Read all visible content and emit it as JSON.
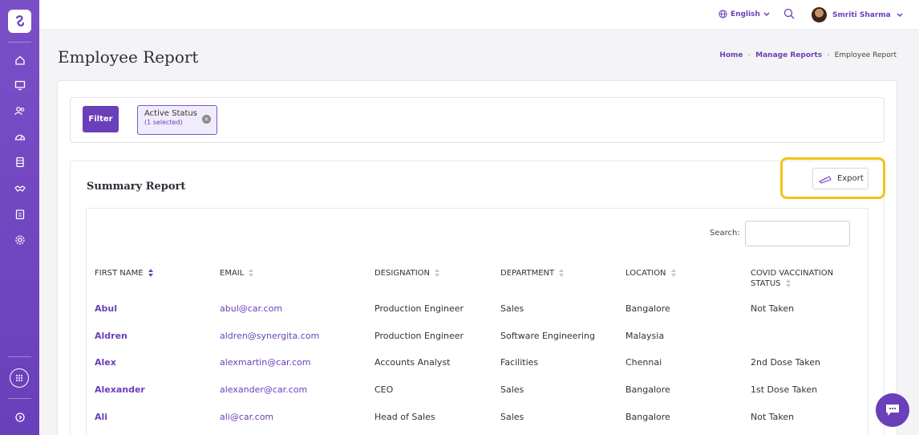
{
  "sidebar": {
    "icons": [
      "logo-icon",
      "home-icon",
      "monitor-icon",
      "users-icon",
      "dashboard-icon",
      "database-icon",
      "handshake-icon",
      "clipboard-icon",
      "settings-icon",
      "apps-icon",
      "info-icon"
    ]
  },
  "topbar": {
    "language": "English",
    "user_name": "Smriti Sharma"
  },
  "page": {
    "title": "Employee Report",
    "breadcrumb": [
      "Home",
      "Manage Reports",
      "Employee Report"
    ]
  },
  "filter": {
    "button_label": "Filter",
    "chip_title": "Active Status",
    "chip_subtitle": "(1 selected)",
    "chip_close": "×"
  },
  "summary": {
    "title": "Summary Report",
    "export_label": "Export",
    "search_label": "Search:",
    "search_value": ""
  },
  "table": {
    "columns": [
      "FIRST NAME",
      "EMAIL",
      "DESIGNATION",
      "DEPARTMENT",
      "LOCATION",
      "COVID VACCINATION",
      "STATUS"
    ],
    "rows": [
      {
        "name": "Abul",
        "email": "abul@car.com",
        "designation": "Production Engineer",
        "department": "Sales",
        "location": "Bangalore",
        "status": "Not Taken"
      },
      {
        "name": "Aldren",
        "email": "aldren@synergita.com",
        "designation": "Production Engineer",
        "department": "Software Engineering",
        "location": "Malaysia",
        "status": ""
      },
      {
        "name": "Alex",
        "email": "alexmartin@car.com",
        "designation": "Accounts Analyst",
        "department": "Facilities",
        "location": "Chennai",
        "status": "2nd Dose Taken"
      },
      {
        "name": "Alexander",
        "email": "alexander@car.com",
        "designation": "CEO",
        "department": "Sales",
        "location": "Bangalore",
        "status": "1st Dose Taken"
      },
      {
        "name": "Ali",
        "email": "ali@car.com",
        "designation": "Head of Sales",
        "department": "Sales",
        "location": "Bangalore",
        "status": "Not Taken"
      }
    ]
  },
  "colors": {
    "brand": "#6a3fba",
    "highlight": "#f0c419"
  }
}
